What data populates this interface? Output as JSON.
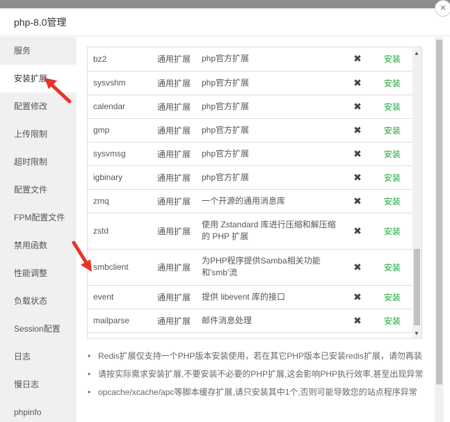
{
  "dialog": {
    "title": "php-8.0管理",
    "close_glyph": "×"
  },
  "sidebar": {
    "items": [
      {
        "label": "服务"
      },
      {
        "label": "安装扩展"
      },
      {
        "label": "配置修改"
      },
      {
        "label": "上传限制"
      },
      {
        "label": "超时限制"
      },
      {
        "label": "配置文件"
      },
      {
        "label": "FPM配置文件"
      },
      {
        "label": "禁用函数"
      },
      {
        "label": "性能调整"
      },
      {
        "label": "负载状态"
      },
      {
        "label": "Session配置"
      },
      {
        "label": "日志"
      },
      {
        "label": "慢日志"
      },
      {
        "label": "phpinfo"
      }
    ]
  },
  "extensions": [
    {
      "name": "bz2",
      "type": "通用扩展",
      "desc": "php官方扩展",
      "status": "✖",
      "action": "安装"
    },
    {
      "name": "sysvshm",
      "type": "通用扩展",
      "desc": "php官方扩展",
      "status": "✖",
      "action": "安装"
    },
    {
      "name": "calendar",
      "type": "通用扩展",
      "desc": "php官方扩展",
      "status": "✖",
      "action": "安装"
    },
    {
      "name": "gmp",
      "type": "通用扩展",
      "desc": "php官方扩展",
      "status": "✖",
      "action": "安装"
    },
    {
      "name": "sysvmsg",
      "type": "通用扩展",
      "desc": "php官方扩展",
      "status": "✖",
      "action": "安装"
    },
    {
      "name": "igbinary",
      "type": "通用扩展",
      "desc": "php官方扩展",
      "status": "✖",
      "action": "安装"
    },
    {
      "name": "zmq",
      "type": "通用扩展",
      "desc": "一个开源的通用消息库",
      "status": "✖",
      "action": "安装"
    },
    {
      "name": "zstd",
      "type": "通用扩展",
      "desc": "使用 Zstandard 库进行压缩和解压缩的 PHP 扩展",
      "status": "✖",
      "action": "安装"
    },
    {
      "name": "smbclient",
      "type": "通用扩展",
      "desc": "为PHP程序提供Samba相关功能和'smb'流",
      "status": "✖",
      "action": "安装"
    },
    {
      "name": "event",
      "type": "通用扩展",
      "desc": "提供 libevent 库的接口",
      "status": "✖",
      "action": "安装"
    },
    {
      "name": "mailparse",
      "type": "通用扩展",
      "desc": "邮件消息处理",
      "status": "✖",
      "action": "安装"
    }
  ],
  "notes": [
    "Redis扩展仅支持一个PHP版本安装使用，若在其它PHP版本已安装redis扩展，请勿再装",
    "请按实际需求安装扩展,不要安装不必要的PHP扩展,这会影响PHP执行效率,甚至出现异常",
    "opcache/xcache/apc等脚本缓存扩展,请只安装其中1个,否则可能导致您的站点程序异常"
  ],
  "colors": {
    "install": "#20a53a",
    "arrow": "#e8342a",
    "sidebar_bg": "#f0f0f0"
  }
}
